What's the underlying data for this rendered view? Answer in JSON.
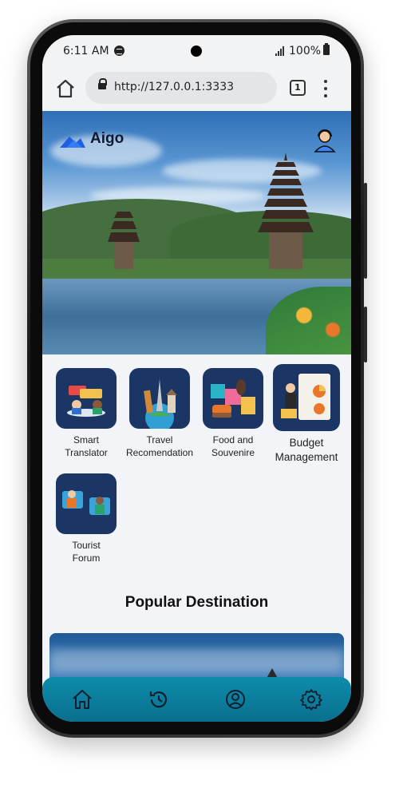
{
  "status_bar": {
    "time": "6:11 AM",
    "battery": "100%"
  },
  "browser": {
    "url": "http://127.0.0.1:3333",
    "tab_count": "1"
  },
  "app": {
    "brand": "Aigo",
    "accent_color": "#1b3564",
    "nav_color": "#0e8cab"
  },
  "features": [
    {
      "label_line1": "Smart",
      "label_line2": "Translator",
      "icon": "translator-icon"
    },
    {
      "label_line1": "Travel",
      "label_line2": "Recomendation",
      "icon": "travel-icon"
    },
    {
      "label_line1": "Food and",
      "label_line2": "Souvenire",
      "icon": "food-icon"
    },
    {
      "label_line1": "Budget",
      "label_line2": "Management",
      "icon": "budget-icon"
    },
    {
      "label_line1": "Tourist",
      "label_line2": "Forum",
      "icon": "forum-icon"
    }
  ],
  "section": {
    "popular_title": "Popular Destination"
  },
  "bottom_nav": [
    {
      "name": "home",
      "icon": "home-icon"
    },
    {
      "name": "history",
      "icon": "history-icon"
    },
    {
      "name": "profile",
      "icon": "profile-icon"
    },
    {
      "name": "settings",
      "icon": "settings-icon"
    }
  ]
}
